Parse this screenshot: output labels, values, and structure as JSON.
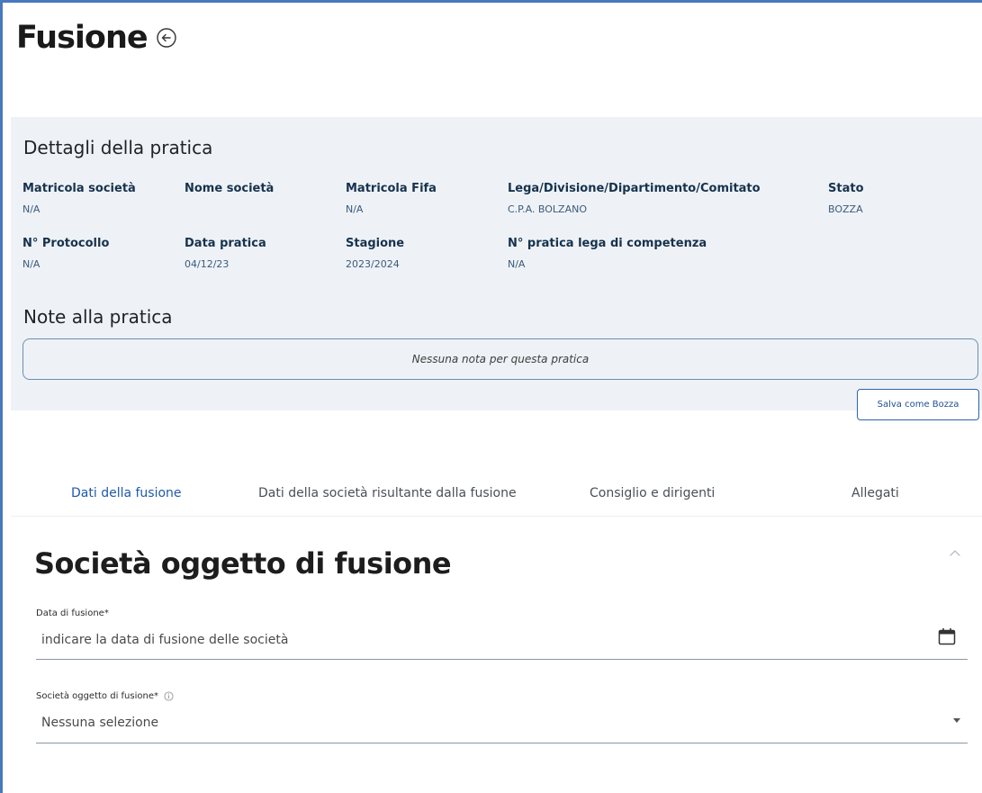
{
  "page": {
    "title": "Fusione"
  },
  "details": {
    "section_title": "Dettagli della pratica",
    "fields": [
      {
        "label": "Matricola società",
        "value": "N/A"
      },
      {
        "label": "Nome società",
        "value": ""
      },
      {
        "label": "Matricola Fifa",
        "value": "N/A"
      },
      {
        "label": "Lega/Divisione/Dipartimento/Comitato",
        "value": "C.P.A. BOLZANO"
      },
      {
        "label": "Stato",
        "value": "BOZZA"
      },
      {
        "label": "N° Protocollo",
        "value": "N/A"
      },
      {
        "label": "Data pratica",
        "value": "04/12/23"
      },
      {
        "label": "Stagione",
        "value": "2023/2024"
      },
      {
        "label": "N° pratica lega di competenza",
        "value": "N/A"
      }
    ],
    "notes_title": "Note alla pratica",
    "notes_placeholder": "Nessuna nota per questa pratica",
    "save_draft_label": "Salva come Bozza"
  },
  "tabs": [
    {
      "label": "Dati della fusione",
      "active": true
    },
    {
      "label": "Dati della società risultante dalla fusione",
      "active": false
    },
    {
      "label": "Consiglio e dirigenti",
      "active": false
    },
    {
      "label": "Allegati",
      "active": false
    }
  ],
  "form": {
    "heading": "Società oggetto di fusione",
    "date_field": {
      "label": "Data di fusione*",
      "placeholder": "indicare la data di fusione delle società"
    },
    "company_field": {
      "label": "Società oggetto di fusione*",
      "value": "Nessuna selezione"
    }
  },
  "icons": {
    "back": "arrow-left-circle-icon",
    "collapse": "chevron-up-icon",
    "calendar": "calendar-icon",
    "info": "info-icon",
    "dropdown": "caret-down-icon"
  },
  "colors": {
    "accent": "#1e5aa8",
    "panel_bg": "#eef2f6",
    "label": "#17324d"
  }
}
